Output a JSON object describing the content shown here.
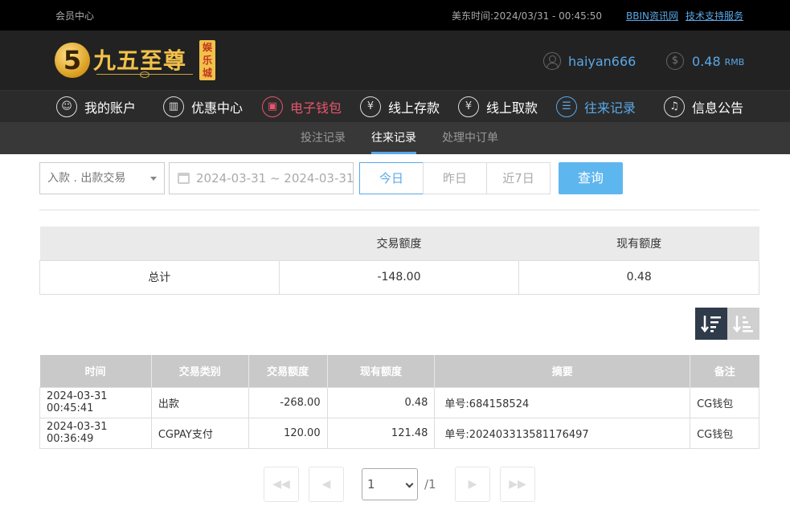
{
  "topbar": {
    "member_center": "会员中心",
    "time_label": "美东时间:",
    "time_value": "2024/03/31 - 00:45:50",
    "link1": "BBIN资讯网",
    "link2": "技术支持服务"
  },
  "header": {
    "logo_digit": "5",
    "logo_text": "九五至尊",
    "logo_badge": "娱乐城",
    "username": "haiyan666",
    "balance": "0.48",
    "currency": "RMB"
  },
  "nav": {
    "items": [
      {
        "label": "我的账户",
        "icon": "user-icon"
      },
      {
        "label": "优惠中心",
        "icon": "gift-icon"
      },
      {
        "label": "电子钱包",
        "icon": "wallet-icon"
      },
      {
        "label": "线上存款",
        "icon": "deposit-icon"
      },
      {
        "label": "线上取款",
        "icon": "withdraw-icon"
      },
      {
        "label": "往来记录",
        "icon": "records-icon"
      },
      {
        "label": "信息公告",
        "icon": "bell-icon"
      }
    ]
  },
  "subnav": {
    "items": [
      "投注记录",
      "往来记录",
      "处理中订单"
    ],
    "active_index": 1
  },
  "filter": {
    "type_select": "入款 . 出款交易",
    "date_range": "2024-03-31 ~ 2024-03-31",
    "btn_today": "今日",
    "btn_yesterday": "昨日",
    "btn_week": "近7日",
    "btn_query": "查询"
  },
  "summary": {
    "headers": [
      "",
      "交易额度",
      "现有额度"
    ],
    "row": [
      "总计",
      "-148.00",
      "0.48"
    ]
  },
  "records": {
    "headers": [
      "时间",
      "交易类别",
      "交易额度",
      "现有额度",
      "摘要",
      "备注"
    ],
    "rows": [
      [
        "2024-03-31 00:45:41",
        "出款",
        "-268.00",
        "0.48",
        "单号:684158524",
        "CG钱包"
      ],
      [
        "2024-03-31 00:36:49",
        "CGPAY支付",
        "120.00",
        "121.48",
        "单号:202403313581176497",
        "CG钱包"
      ]
    ]
  },
  "pagination": {
    "current": "1",
    "total": "/1"
  },
  "colors": {
    "accent": "#5aa8e8",
    "active_red": "#e8556b",
    "query_button": "#5eb6ef"
  }
}
